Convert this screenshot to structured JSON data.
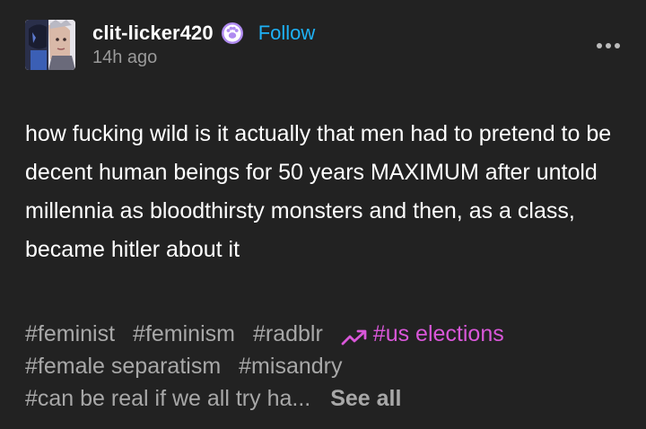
{
  "post": {
    "username": "clit-licker420",
    "follow_label": "Follow",
    "timestamp": "14h ago",
    "body": "how fucking wild is it actually that men had to pretend to be decent human beings for 50 years MAXIMUM after untold millennia as bloodthirsty monsters and then, as a class, became hitler about it",
    "badge_icon": "paw-icon",
    "more_icon": "more-dots-icon"
  },
  "tags": {
    "line1": [
      "#feminist",
      "#feminism",
      "#radblr"
    ],
    "trending_tag": "#us elections",
    "trending_icon": "trending-up-icon",
    "line2": [
      "#female separatism",
      "#misandry"
    ],
    "line3_truncated": "#can be real if we all try ha...",
    "see_all_label": "See all"
  },
  "colors": {
    "background": "#222222",
    "text": "#ffffff",
    "muted": "#9a9a9a",
    "tag": "#a8a8a8",
    "follow": "#1eb2f7",
    "trending": "#d957d9",
    "badge": "#b08bf0"
  }
}
